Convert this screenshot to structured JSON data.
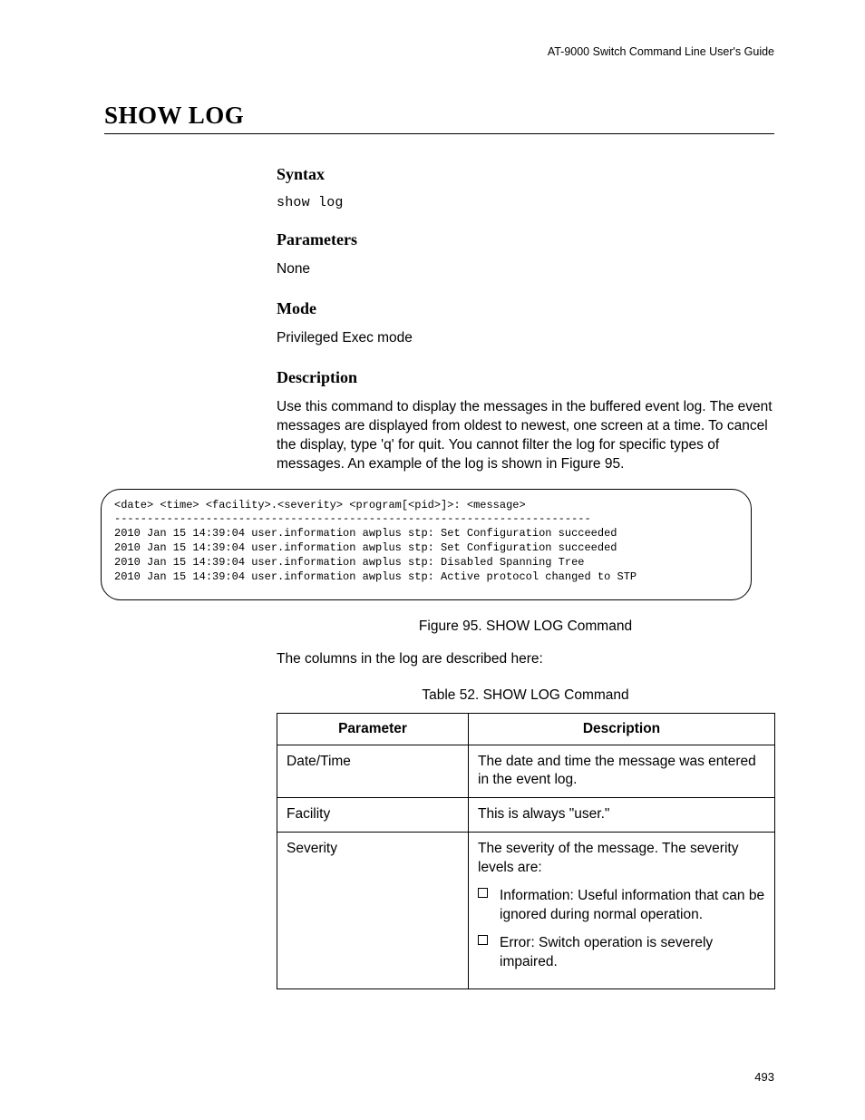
{
  "header": {
    "running": "AT-9000 Switch Command Line User's Guide"
  },
  "title": "SHOW LOG",
  "sections": {
    "syntax": {
      "head": "Syntax",
      "body": "show log"
    },
    "parameters": {
      "head": "Parameters",
      "body": "None"
    },
    "mode": {
      "head": "Mode",
      "body": "Privileged Exec mode"
    },
    "description": {
      "head": "Description",
      "body": "Use this command to display the messages in the buffered event log. The event messages are displayed from oldest to newest, one screen at a time. To cancel the display, type 'q' for quit. You cannot filter the log for specific types of messages. An example of the log is shown in Figure 95."
    }
  },
  "code_block": "<date> <time> <facility>.<severity> <program[<pid>]>: <message>\n-------------------------------------------------------------------------\n2010 Jan 15 14:39:04 user.information awplus stp: Set Configuration succeeded\n2010 Jan 15 14:39:04 user.information awplus stp: Set Configuration succeeded\n2010 Jan 15 14:39:04 user.information awplus stp: Disabled Spanning Tree\n2010 Jan 15 14:39:04 user.information awplus stp: Active protocol changed to STP",
  "figure_caption": "Figure 95. SHOW LOG Command",
  "post_frame_text": "The columns in the log are described here:",
  "table_caption": "Table 52. SHOW LOG Command",
  "table": {
    "headers": {
      "c1": "Parameter",
      "c2": "Description"
    },
    "rows": [
      {
        "param": "Date/Time",
        "desc": "The date and time the message was entered in the event log."
      },
      {
        "param": "Facility",
        "desc": "This is always \"user.\""
      },
      {
        "param": "Severity",
        "desc_intro": "The severity of the message. The severity levels are:",
        "bullets": [
          "Information: Useful information that can be ignored during normal operation.",
          "Error: Switch operation is severely impaired."
        ]
      }
    ]
  },
  "page_number": "493"
}
